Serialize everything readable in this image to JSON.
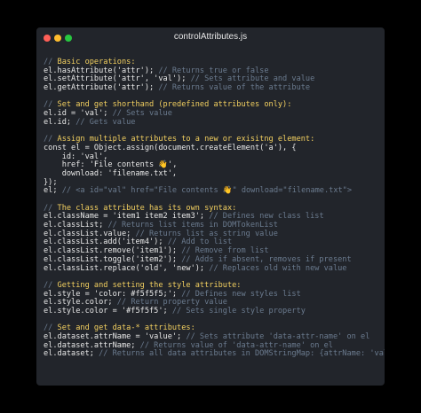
{
  "window": {
    "title": "controlAttributes.js"
  },
  "code_lines": [
    [
      {
        "c": "// ",
        "t": "comment"
      },
      {
        "c": "Basic operations:",
        "t": "yellow"
      }
    ],
    [
      {
        "c": "el.hasAttribute('attr'); ",
        "t": "plain"
      },
      {
        "c": "// Returns true or false",
        "t": "comment"
      }
    ],
    [
      {
        "c": "el.setAttribute('attr', 'val'); ",
        "t": "plain"
      },
      {
        "c": "// Sets attribute and value",
        "t": "comment"
      }
    ],
    [
      {
        "c": "el.getAttribute('attr'); ",
        "t": "plain"
      },
      {
        "c": "// Returns value of the attribute",
        "t": "comment"
      }
    ],
    [],
    [
      {
        "c": "// ",
        "t": "comment"
      },
      {
        "c": "Set and get shorthand (predefined attributes only):",
        "t": "yellow"
      }
    ],
    [
      {
        "c": "el.id = 'val'; ",
        "t": "plain"
      },
      {
        "c": "// Sets value",
        "t": "comment"
      }
    ],
    [
      {
        "c": "el.id; ",
        "t": "plain"
      },
      {
        "c": "// Gets value",
        "t": "comment"
      }
    ],
    [],
    [
      {
        "c": "// ",
        "t": "comment"
      },
      {
        "c": "Assign multiple attributes to a new or exisitng element:",
        "t": "yellow"
      }
    ],
    [
      {
        "c": "const el = Object.assign(document.createElement('a'), {",
        "t": "plain"
      }
    ],
    [
      {
        "c": "    id: 'val',",
        "t": "plain"
      }
    ],
    [
      {
        "c": "    href: 'File contents 👋',",
        "t": "plain"
      }
    ],
    [
      {
        "c": "    download: 'filename.txt',",
        "t": "plain"
      }
    ],
    [
      {
        "c": "});",
        "t": "plain"
      }
    ],
    [
      {
        "c": "el; ",
        "t": "plain"
      },
      {
        "c": "// <a id=\"val\" href=\"File contents 👋\" download=\"filename.txt\">",
        "t": "comment"
      }
    ],
    [],
    [
      {
        "c": "// ",
        "t": "comment"
      },
      {
        "c": "The class attribute has its own syntax:",
        "t": "yellow"
      }
    ],
    [
      {
        "c": "el.className = 'item1 item2 item3'; ",
        "t": "plain"
      },
      {
        "c": "// Defines new class list",
        "t": "comment"
      }
    ],
    [
      {
        "c": "el.classList; ",
        "t": "plain"
      },
      {
        "c": "// Returns list items in DOMTokenList",
        "t": "comment"
      }
    ],
    [
      {
        "c": "el.classList.value; ",
        "t": "plain"
      },
      {
        "c": "// Returns list as string value",
        "t": "comment"
      }
    ],
    [
      {
        "c": "el.classList.add('item4'); ",
        "t": "plain"
      },
      {
        "c": "// Add to list",
        "t": "comment"
      }
    ],
    [
      {
        "c": "el.classList.remove('item1'); ",
        "t": "plain"
      },
      {
        "c": "// Remove from list",
        "t": "comment"
      }
    ],
    [
      {
        "c": "el.classList.toggle('item2'); ",
        "t": "plain"
      },
      {
        "c": "// Adds if absent, removes if present",
        "t": "comment"
      }
    ],
    [
      {
        "c": "el.classList.replace('old', 'new'); ",
        "t": "plain"
      },
      {
        "c": "// Replaces old with new value",
        "t": "comment"
      }
    ],
    [],
    [
      {
        "c": "// ",
        "t": "comment"
      },
      {
        "c": "Getting and setting the style attribute:",
        "t": "yellow"
      }
    ],
    [
      {
        "c": "el.style = 'color: #f5f5f5;'; ",
        "t": "plain"
      },
      {
        "c": "// Defines new styles list",
        "t": "comment"
      }
    ],
    [
      {
        "c": "el.style.color; ",
        "t": "plain"
      },
      {
        "c": "// Return property value",
        "t": "comment"
      }
    ],
    [
      {
        "c": "el.style.color = '#f5f5f5'; ",
        "t": "plain"
      },
      {
        "c": "// Sets single style property",
        "t": "comment"
      }
    ],
    [],
    [
      {
        "c": "// ",
        "t": "comment"
      },
      {
        "c": "Set and get data-* attributes:",
        "t": "yellow"
      }
    ],
    [
      {
        "c": "el.dataset.attrName = 'value'; ",
        "t": "plain"
      },
      {
        "c": "// Sets attribute 'data-attr-name' on el",
        "t": "comment"
      }
    ],
    [
      {
        "c": "el.dataset.attrName; ",
        "t": "plain"
      },
      {
        "c": "// Returns value of 'data-attr-name' on el",
        "t": "comment"
      }
    ],
    [
      {
        "c": "el.dataset; ",
        "t": "plain"
      },
      {
        "c": "// Returns all data attributes in DOMStringMap: {attrName: 'value'}",
        "t": "comment"
      }
    ]
  ]
}
